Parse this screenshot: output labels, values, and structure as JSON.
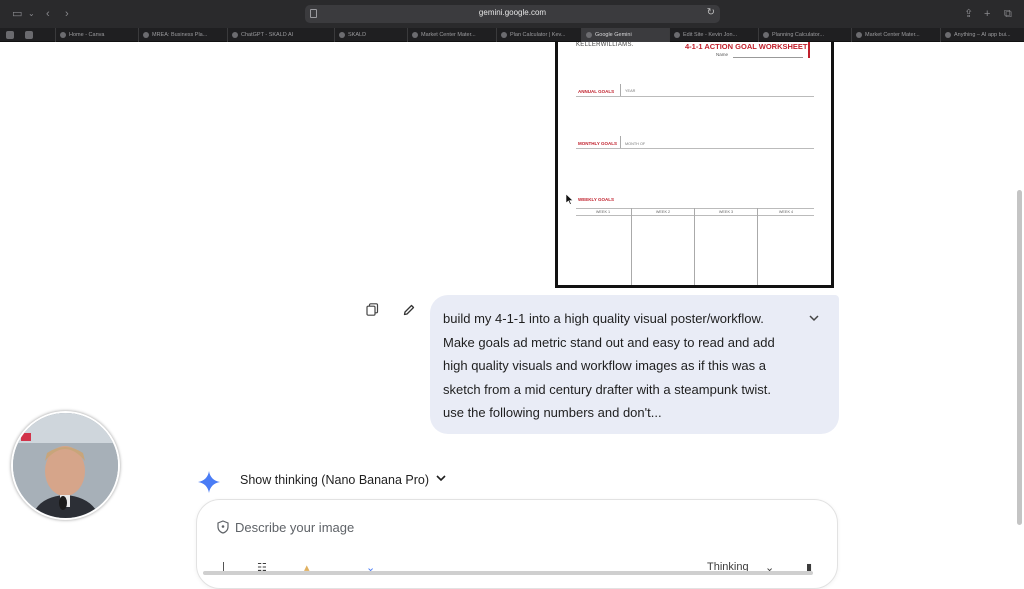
{
  "browser": {
    "url": "gemini.google.com",
    "tabs": [
      {
        "label": "Home - Canva",
        "active": false
      },
      {
        "label": "MREA: Business Pla...",
        "active": false
      },
      {
        "label": "ChatGPT - SKALD AI",
        "active": false
      },
      {
        "label": "SKALD",
        "active": false
      },
      {
        "label": "Market Center Mater...",
        "active": false
      },
      {
        "label": "Plan Calculator | Kev...",
        "active": false
      },
      {
        "label": "Google Gemini",
        "active": true
      },
      {
        "label": "Edit Site - Kevin Jon...",
        "active": false
      },
      {
        "label": "Planning Calculator...",
        "active": false
      },
      {
        "label": "Market Center Mater...",
        "active": false
      },
      {
        "label": "Anything – AI app bui...",
        "active": false
      }
    ]
  },
  "poster": {
    "brand": "KELLERWILLIAMS.",
    "title": "4-1-1 ACTION GOAL WORKSHEET",
    "name_label": "Name",
    "annual_label": "ANNUAL GOALS",
    "annual_sub": "YEAR",
    "monthly_label": "MONTHLY GOALS",
    "monthly_sub": "MONTH OF",
    "weekly_label": "WEEKLY GOALS",
    "weeks": [
      "WEEK 1",
      "WEEK 2",
      "WEEK 3",
      "WEEK 4"
    ]
  },
  "chat": {
    "user_message": "build my 4-1-1 into a high quality visual poster/workflow. Make goals ad metric stand out and easy to read and add high quality visuals and workflow images as if this was a sketch from a mid century drafter with a steampunk twist. use the following numbers and don't...",
    "thinking_label": "Show thinking (Nano Banana Pro)",
    "input_placeholder": "Describe your image",
    "mode_label": "Thinking"
  },
  "icons": {
    "copy": "copy-icon",
    "edit": "pencil-icon",
    "expand": "chevron-down-icon",
    "gemini": "gemini-spark-icon",
    "shield": "shield-icon"
  },
  "colors": {
    "bubble": "#e9ecf6",
    "accent_red": "#c0202c",
    "gemini_blue": "#4a7cf5"
  }
}
